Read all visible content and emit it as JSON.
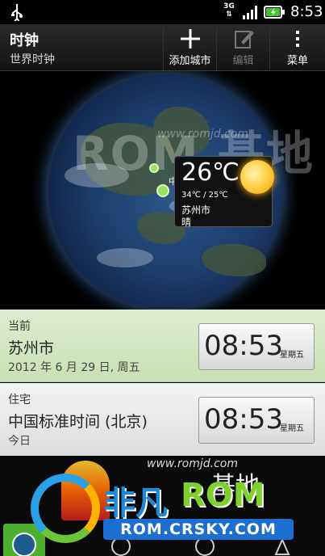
{
  "status_bar": {
    "network": "3G",
    "time": "8:53"
  },
  "action_bar": {
    "title": "时钟",
    "subtitle": "世界时钟",
    "add_city_label": "添加城市",
    "edit_label": "编辑",
    "menu_label": "菜单"
  },
  "globe": {
    "watermark_text": "ROM 基地",
    "watermark_url": "www.romjd.com",
    "pin_label": "中",
    "weather": {
      "temperature": "26℃",
      "range": "34℃ / 25℃",
      "city": "苏州市",
      "condition": "晴"
    }
  },
  "clocks": [
    {
      "tag": "当前",
      "city": "苏州市",
      "detail": "2012 年 6 月 29 日, 周五",
      "time": "08:53",
      "weekday": "星期五"
    },
    {
      "tag": "住宅",
      "city": "中国标准时间 (北京)",
      "detail": "今日",
      "time": "08:53",
      "weekday": "星期五"
    }
  ],
  "bottom_banner": {
    "url": "www.romjd.com",
    "cn_text": "基地",
    "brand_cn": "非凡",
    "brand_en": "ROM",
    "site": "ROM.CRSKY.COM"
  },
  "tabs": [
    {
      "icon": "world-clock-icon"
    },
    {
      "icon": "alarm-icon"
    },
    {
      "icon": "stopwatch-icon"
    },
    {
      "icon": "timer-icon"
    }
  ],
  "colors": {
    "current_row_bg": "#c9e0b2",
    "active_tab": "#4caf2e",
    "brand_blue": "#1c8ad8",
    "brand_green": "#7dd12a"
  }
}
